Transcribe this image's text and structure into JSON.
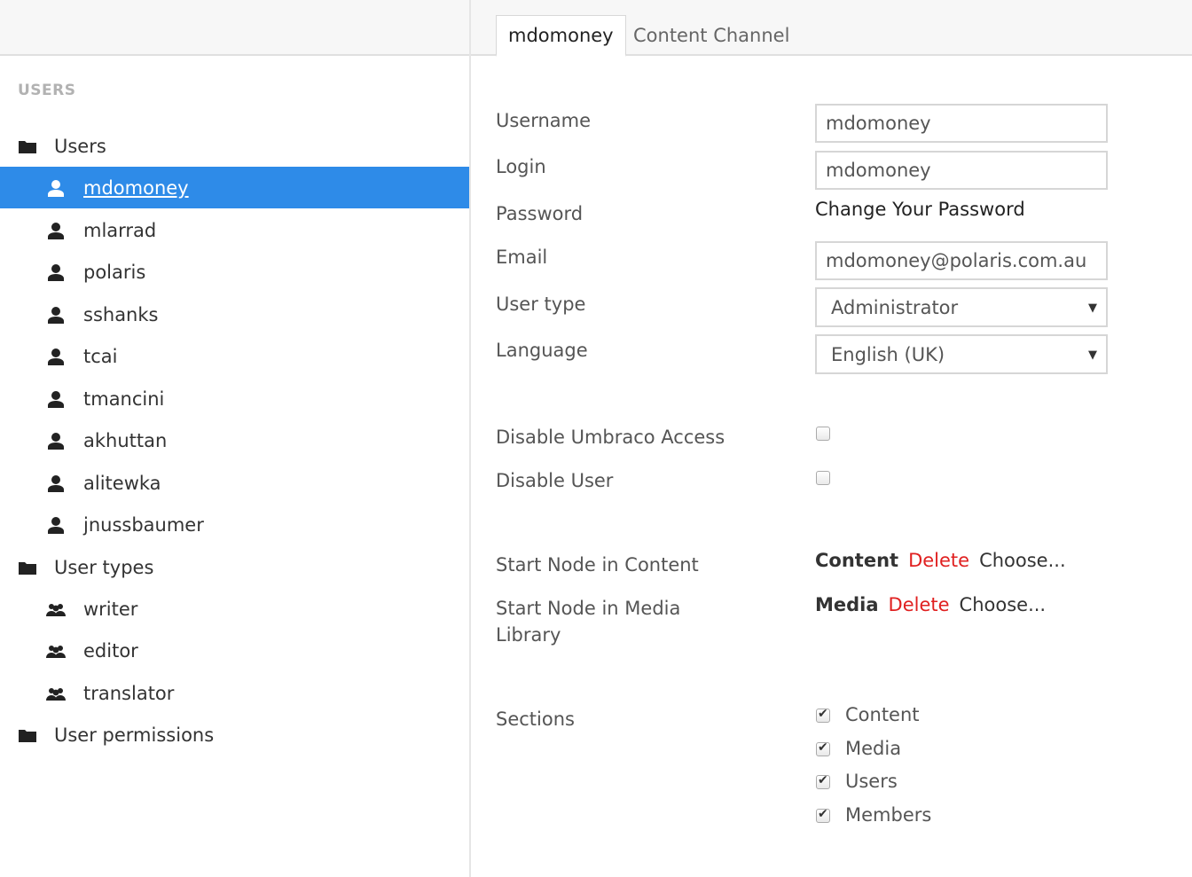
{
  "tree": {
    "title": "USERS",
    "items": [
      {
        "label": "Users",
        "icon": "folder-icon",
        "level": 0
      },
      {
        "label": "mdomoney",
        "icon": "user-icon",
        "level": 1,
        "selected": true
      },
      {
        "label": "mlarrad",
        "icon": "user-icon",
        "level": 1
      },
      {
        "label": "polaris",
        "icon": "user-icon",
        "level": 1
      },
      {
        "label": "sshanks",
        "icon": "user-icon",
        "level": 1
      },
      {
        "label": "tcai",
        "icon": "user-icon",
        "level": 1
      },
      {
        "label": "tmancini",
        "icon": "user-icon",
        "level": 1
      },
      {
        "label": "akhuttan",
        "icon": "user-icon",
        "level": 1
      },
      {
        "label": "alitewka",
        "icon": "user-icon",
        "level": 1
      },
      {
        "label": "jnussbaumer",
        "icon": "user-icon",
        "level": 1
      },
      {
        "label": "User types",
        "icon": "folder-icon",
        "level": 0
      },
      {
        "label": "writer",
        "icon": "users-group-icon",
        "level": 1
      },
      {
        "label": "editor",
        "icon": "users-group-icon",
        "level": 1
      },
      {
        "label": "translator",
        "icon": "users-group-icon",
        "level": 1
      },
      {
        "label": "User permissions",
        "icon": "folder-icon",
        "level": 0
      }
    ]
  },
  "tabs": [
    {
      "label": "mdomoney",
      "active": true
    },
    {
      "label": "Content Channel",
      "active": false
    }
  ],
  "form": {
    "username_label": "Username",
    "username_value": "mdomoney",
    "login_label": "Login",
    "login_value": "mdomoney",
    "password_label": "Password",
    "password_link": "Change Your Password",
    "email_label": "Email",
    "email_value": "mdomoney@polaris.com.au",
    "usertype_label": "User type",
    "usertype_value": "Administrator",
    "language_label": "Language",
    "language_value": "English (UK)",
    "disable_access_label": "Disable Umbraco Access",
    "disable_access_checked": false,
    "disable_user_label": "Disable User",
    "disable_user_checked": false,
    "start_content_label": "Start Node in Content",
    "start_content_node": "Content",
    "start_media_label_line1": "Start Node in Media",
    "start_media_label_line2": "Library",
    "start_media_node": "Media",
    "delete_label": "Delete",
    "choose_label": "Choose...",
    "sections_label": "Sections",
    "sections": [
      {
        "label": "Content",
        "checked": true
      },
      {
        "label": "Media",
        "checked": true
      },
      {
        "label": "Users",
        "checked": true
      },
      {
        "label": "Members",
        "checked": true
      }
    ]
  },
  "colors": {
    "selected": "#2e8be8",
    "delete": "#e02020"
  }
}
